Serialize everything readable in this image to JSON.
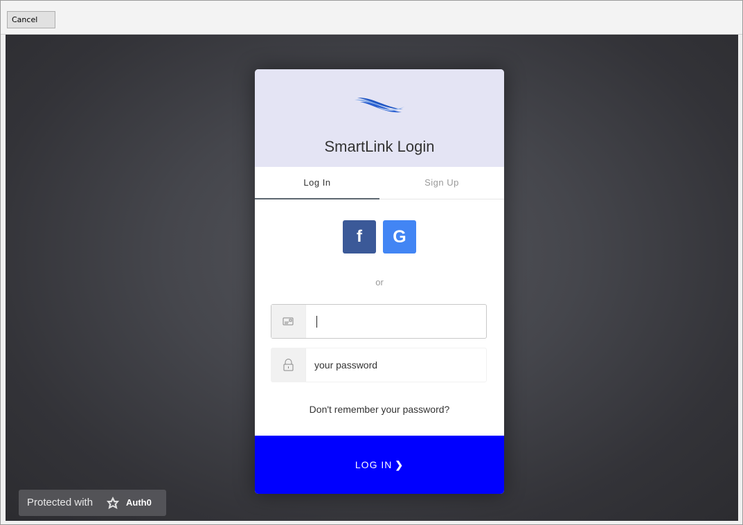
{
  "toolbar": {
    "cancel_label": "Cancel"
  },
  "card": {
    "title": "SmartLink Login",
    "logo_icon": "waves-icon",
    "header_color": "#e4e4f4",
    "accent_color": "#0000ff"
  },
  "tabs": [
    {
      "label": "Log In",
      "active": true
    },
    {
      "label": "Sign Up",
      "active": false
    }
  ],
  "social": {
    "facebook_glyph": "f",
    "google_glyph": "G"
  },
  "divider_text": "or",
  "email": {
    "value": "",
    "icon": "email-card-icon"
  },
  "password": {
    "placeholder": "your password",
    "icon": "lock-icon"
  },
  "forgot_link": "Don't remember your password?",
  "submit_label": "LOG IN",
  "submit_chevron": "❯",
  "badge": {
    "text": "Protected with",
    "brand": "Auth0"
  }
}
